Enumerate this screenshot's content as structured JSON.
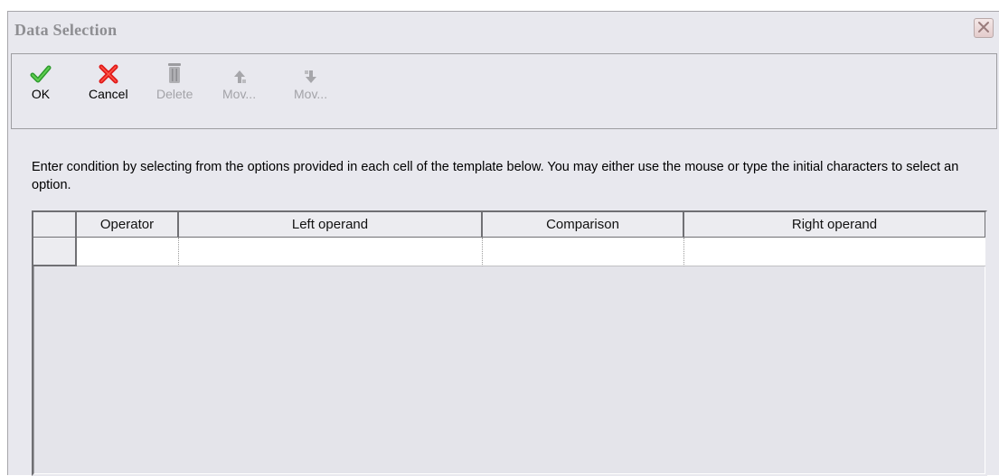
{
  "window": {
    "title": "Data Selection"
  },
  "toolbar": {
    "buttons": [
      {
        "label": "OK",
        "icon": "checkmark-icon",
        "enabled": true
      },
      {
        "label": "Cancel",
        "icon": "x-icon",
        "enabled": true
      },
      {
        "label": "Delete",
        "icon": "trash-icon",
        "enabled": false
      },
      {
        "label": "Mov...",
        "icon": "arrow-up-icon",
        "enabled": false
      },
      {
        "label": "Mov...",
        "icon": "arrow-down-icon",
        "enabled": false
      }
    ]
  },
  "instructions": "Enter condition by selecting from the options provided in each cell of the template below. You may either use the mouse or type the initial characters to select an option.",
  "grid": {
    "columns": [
      "",
      "Operator",
      "Left operand",
      "Comparison",
      "Right operand"
    ],
    "rows": [
      {
        "operator": "",
        "left_operand": "",
        "comparison": "",
        "right_operand": ""
      }
    ]
  },
  "colors": {
    "window_bg": "#e8e8ee",
    "ok_green": "#2e9a2e",
    "cancel_red": "#e01818",
    "disabled_gray": "#a3a3a8"
  }
}
